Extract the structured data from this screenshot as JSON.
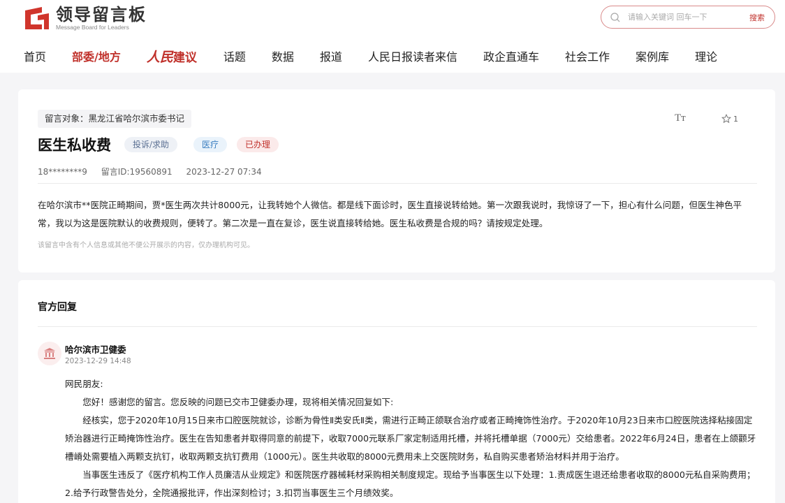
{
  "header": {
    "logo_cn": "领导留言板",
    "logo_en": "Message Board for Leaders",
    "search_placeholder": "请输入关键词 回车一下",
    "search_button": "搜索",
    "nav": [
      {
        "label": "首页"
      },
      {
        "label": "部委/地方"
      },
      {
        "label_script": "人民",
        "label_rest": "建议"
      },
      {
        "label": "话题"
      },
      {
        "label": "数据"
      },
      {
        "label": "报道"
      },
      {
        "label": "人民日报读者来信"
      },
      {
        "label": "政企直通车"
      },
      {
        "label": "社会工作"
      },
      {
        "label": "案例库"
      },
      {
        "label": "理论"
      }
    ]
  },
  "message": {
    "target": "留言对象：黑龙江省哈尔滨市委书记",
    "font_size_icon": "Tт",
    "star_count": "1",
    "title": "医生私收费",
    "tags": [
      "投诉/求助",
      "医疗",
      "已办理"
    ],
    "author": "18********9",
    "message_id": "留言ID:19560891",
    "date": "2023-12-27 07:34",
    "body": "在哈尔滨市**医院正畸期间，贾*医生两次共计8000元，让我转她个人微信。都是线下面诊时，医生直接说转给她。第一次跟我说时，我惊讶了一下，担心有什么问题，但医生神色平常，我以为这是医院默认的收费规则，便转了。第二次是一直在复诊，医生说直接转给她。医生私收费是合规的吗？请按规定处理。",
    "privacy_note": "该留言中含有个人信息或其他不便公开展示的内容，仅办理机构可见。"
  },
  "reply": {
    "heading": "官方回复",
    "org": "哈尔滨市卫健委",
    "time": "2023-12-29 14:48",
    "paragraphs": [
      "网民朋友:",
      "您好！感谢您的留言。您反映的问题已交市卫健委办理，现将相关情况回复如下:",
      "经核实，您于2020年10月15日来市口腔医院就诊，诊断为骨性Ⅱ类安氏Ⅱ类，需进行正畸正颌联合治疗或者正畸掩饰性治疗。于2020年10月23日来市口腔医院选择粘接固定矫治器进行正畸掩饰性治疗。医生在告知患者并取得同意的前提下，收取7000元联系厂家定制适用托槽，并将托槽单据（7000元）交给患者。2022年6月24日，患者在上颌颧牙槽嵴处需要植入两颗支抗钉，收取两颗支抗钉费用（1000元）。医生共收取的8000元费用未上交医院财务，私自购买患者矫治材料并用于治疗。",
      "当事医生违反了《医疗机构工作人员廉洁从业规定》和医院医疗器械耗材采购相关制度规定。现给予当事医生以下处理：1.责成医生退还给患者收取的8000元私自采购费用；2.给予行政警告处分，全院通报批评，作出深刻检讨；3.扣罚当事医生三个月绩效奖。"
    ]
  },
  "colors": {
    "brand_red": "#c0312b",
    "logo_red": "#d0352c"
  }
}
